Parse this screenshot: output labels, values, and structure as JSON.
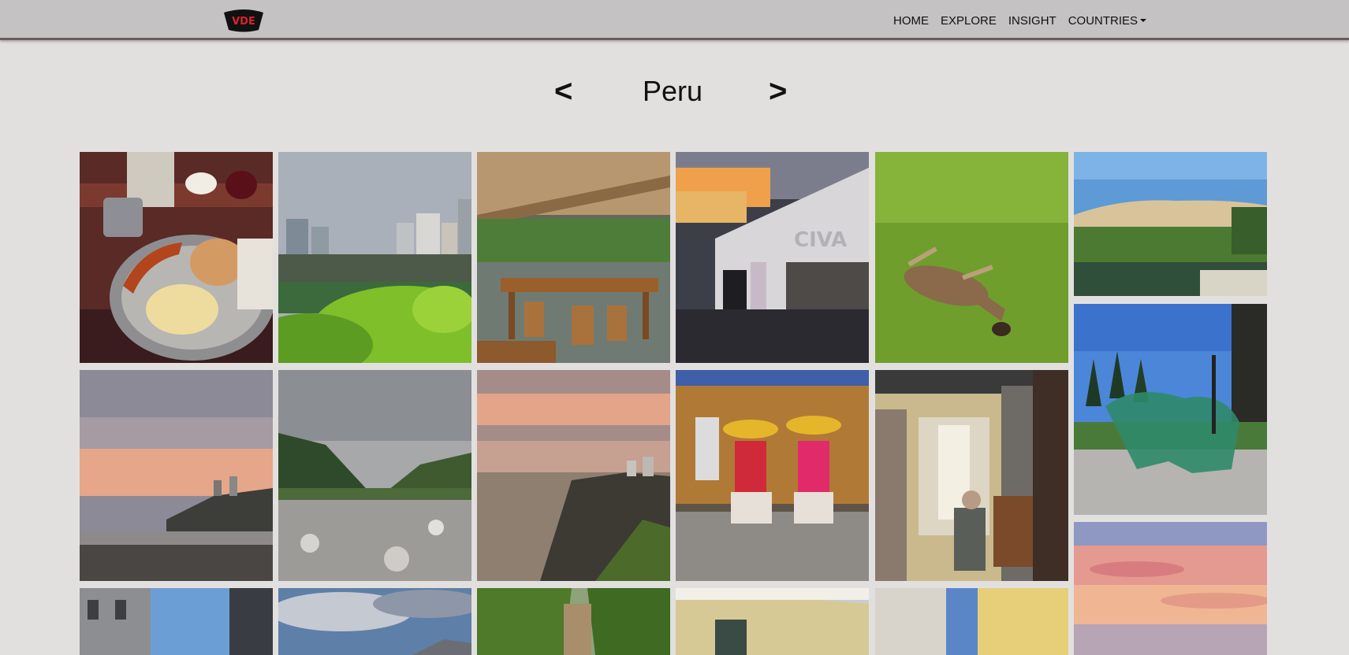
{
  "nav": {
    "logo_text": "VDE",
    "links": [
      "HOME",
      "EXPLORE",
      "INSIGHT",
      "COUNTRIES"
    ]
  },
  "header": {
    "prev_label": "<",
    "next_label": ">",
    "country": "Peru"
  },
  "colors": {
    "page_bg": "#e2e0df",
    "navbar_bg": "#c4c2c3",
    "navbar_border": "#6e5a5d"
  }
}
